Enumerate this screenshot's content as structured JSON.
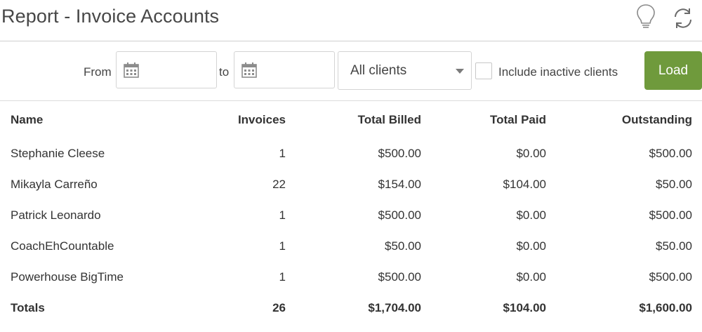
{
  "header": {
    "title": "Report - Invoice Accounts",
    "icons": [
      "lightbulb-icon",
      "refresh-icon"
    ]
  },
  "filters": {
    "from_label": "From",
    "to_label": "to",
    "from_value": "",
    "to_value": "",
    "client_select": "All clients",
    "include_inactive_label": "Include inactive clients",
    "include_inactive_checked": false,
    "load_label": "Load"
  },
  "table": {
    "headers": [
      "Name",
      "Invoices",
      "Total Billed",
      "Total Paid",
      "Outstanding"
    ],
    "rows": [
      [
        "Stephanie Cleese",
        "1",
        "$500.00",
        "$0.00",
        "$500.00"
      ],
      [
        "Mikayla Carreño",
        "22",
        "$154.00",
        "$104.00",
        "$50.00"
      ],
      [
        "Patrick Leonardo",
        "1",
        "$500.00",
        "$0.00",
        "$500.00"
      ],
      [
        "CoachEhCountable",
        "1",
        "$50.00",
        "$0.00",
        "$50.00"
      ],
      [
        "Powerhouse BigTime",
        "1",
        "$500.00",
        "$0.00",
        "$500.00"
      ]
    ],
    "totals": [
      "Totals",
      "26",
      "$1,704.00",
      "$104.00",
      "$1,600.00"
    ]
  },
  "colors": {
    "load_button": "#6f9a3c",
    "text": "#333333",
    "border": "#d4d4d4"
  }
}
